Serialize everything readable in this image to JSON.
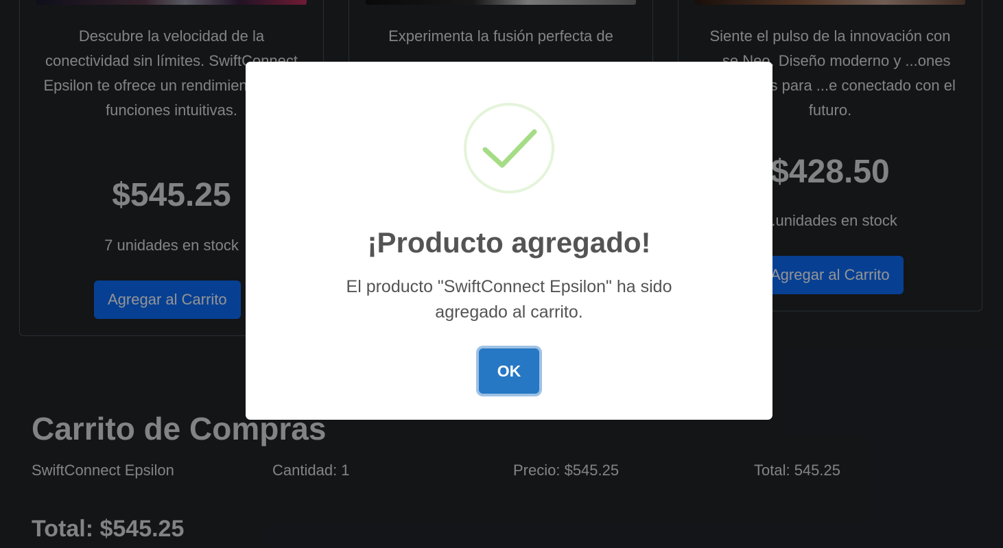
{
  "products": [
    {
      "description": "Descubre la velocidad de la conectividad sin límites. SwiftConnect Epsilon te ofrece un rendimiento ágil y funciones intuitivas.",
      "price": "$545.25",
      "stock": "7 unidades en stock",
      "button_label": "Agregar al Carrito"
    },
    {
      "description": "Experimenta la fusión perfecta de",
      "price": "",
      "stock": "",
      "button_label": ""
    },
    {
      "description": "Siente el pulso de la innovación con ...se Neo. Diseño moderno y ...ones avanzadas para ...e conectado con el futuro.",
      "price": "$428.50",
      "stock": "...unidades en stock",
      "button_label": "Agregar al Carrito"
    }
  ],
  "cart": {
    "title": "Carrito de Compras",
    "items": [
      {
        "name": "SwiftConnect Epsilon",
        "quantity": "Cantidad: 1",
        "price": "Precio: $545.25",
        "total": "Total: 545.25"
      }
    ],
    "grand_total": "Total: $545.25"
  },
  "modal": {
    "title": "¡Producto agregado!",
    "text": "El producto \"SwiftConnect Epsilon\" ha sido agregado al carrito.",
    "ok_label": "OK",
    "icon": "success-check-icon",
    "icon_color": "#a5dc86"
  },
  "colors": {
    "primary_button": "#0d6efd",
    "modal_confirm": "#2778c4",
    "background": "#212529"
  }
}
